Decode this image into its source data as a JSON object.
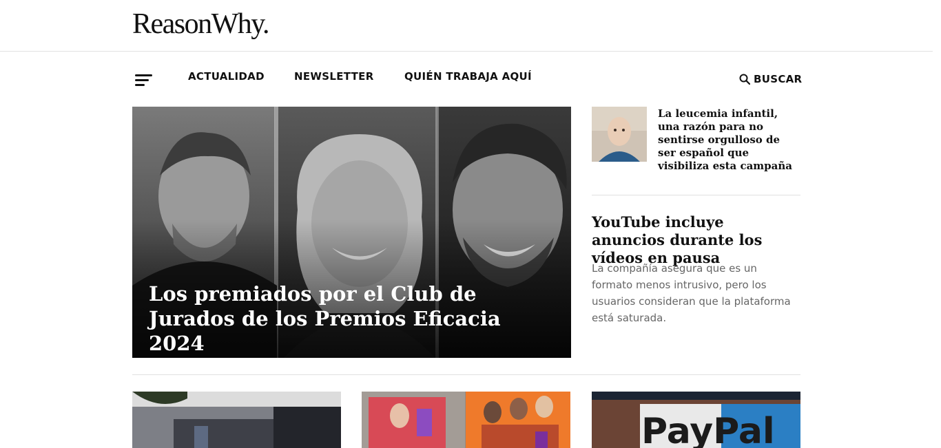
{
  "site": {
    "logo": "ReasonWhy."
  },
  "nav": {
    "items": [
      "ACTUALIDAD",
      "NEWSLETTER",
      "QUIÉN TRABAJA AQUÍ"
    ],
    "search_label": "BUSCAR",
    "menu_icon": "hamburger-menu-icon",
    "search_icon": "search-icon"
  },
  "hero": {
    "title": "Los premiados por el Club de Jurados de los Premios Eficacia 2024"
  },
  "side_story": {
    "title": "La leucemia infantil, una razón para no sentirse orgulloso de ser español que visibiliza esta campaña"
  },
  "featured": {
    "title": "YouTube incluye anuncios durante los vídeos en pausa",
    "description": "La compañía asegura que es un formato menos intrusivo, pero los usuarios consideran que la plataforma está saturada."
  },
  "cards": {
    "paypal_sign": "PayPal"
  },
  "colors": {
    "text": "#111111",
    "muted": "#666666",
    "divider": "#e0e0e0"
  }
}
